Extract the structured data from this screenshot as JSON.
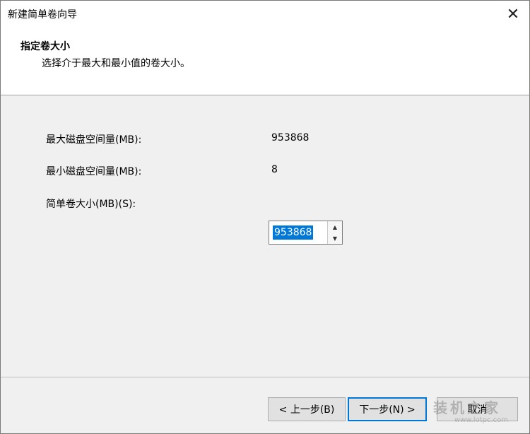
{
  "window": {
    "title": "新建简单卷向导",
    "close_glyph": "✕"
  },
  "header": {
    "title": "指定卷大小",
    "subtitle": "选择介于最大和最小值的卷大小。"
  },
  "form": {
    "max_label": "最大磁盘空间量(MB):",
    "max_value": "953868",
    "min_label": "最小磁盘空间量(MB):",
    "min_value": "8",
    "size_label": "简单卷大小(MB)(S):",
    "size_value": "953868"
  },
  "spinner": {
    "up_glyph": "▲",
    "down_glyph": "▼"
  },
  "buttons": {
    "back": "< 上一步(B)",
    "next": "下一步(N) >",
    "cancel": "取消"
  },
  "watermark": {
    "text": "装机之家",
    "url": "www.lotpc.com"
  },
  "colors": {
    "selection": "#0078d7",
    "default_button_border": "#0078d7"
  }
}
